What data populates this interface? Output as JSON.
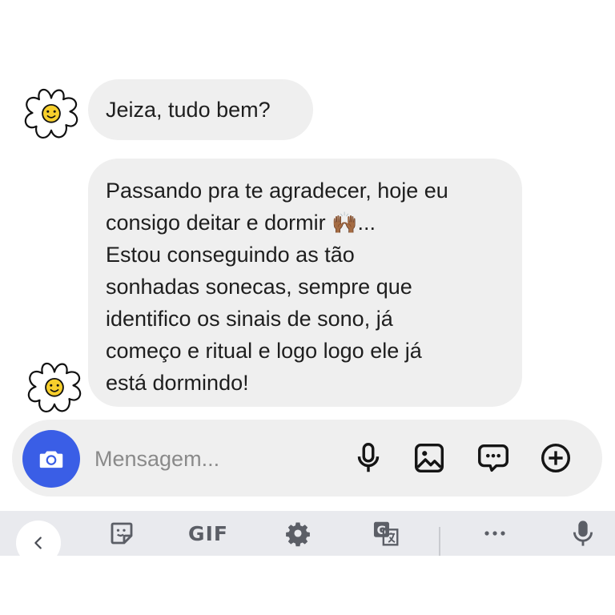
{
  "conversation": {
    "messages": [
      {
        "sender_avatar": "daisy-flower-avatar",
        "text": "Jeiza, tudo bem?"
      },
      {
        "sender_avatar": "daisy-flower-avatar",
        "text_lines": [
          "Passando pra te agradecer, hoje eu",
          "consigo deitar e dormir",
          "...",
          "Estou conseguindo as tão",
          "sonhadas sonecas, sempre que",
          "identifico os sinais de sono, já",
          "começo e ritual e logo logo ele já",
          "está dormindo!"
        ],
        "emoji": "🙌🏾",
        "emoji_name": "raising-hands-emoji"
      }
    ]
  },
  "composer": {
    "placeholder": "Mensagem...",
    "value": "",
    "camera_icon": "camera-icon",
    "icons": [
      "microphone-icon",
      "gallery-image-icon",
      "message-more-icon",
      "add-circle-icon"
    ],
    "accent_color": "#3a5ee6"
  },
  "keyboard_toolbar": {
    "gif_label": "GIF",
    "icons": [
      "chevron-left-icon",
      "sticker-icon",
      "settings-gear-icon",
      "translate-icon",
      "more-dots-icon",
      "voice-input-icon"
    ]
  }
}
